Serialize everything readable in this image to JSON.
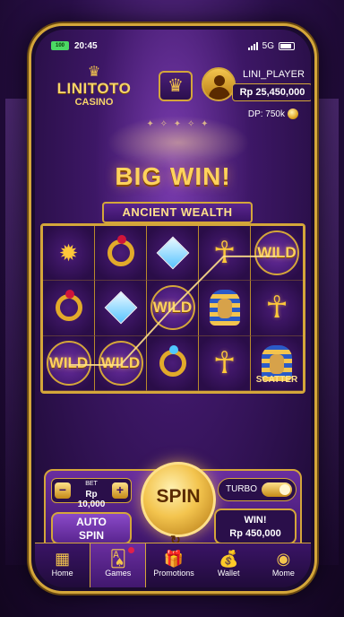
{
  "status_bar": {
    "battery_left": "100",
    "time": "20:45",
    "network": "5G"
  },
  "header": {
    "logo_title": "LINITOTO",
    "logo_subtitle": "CASINO",
    "username": "LINI_PLAYER",
    "balance": "Rp 25,450,000",
    "dp": "DP: 750k"
  },
  "game": {
    "big_win": "BIG WIN!",
    "name": "ANCIENT WEALTH"
  },
  "reels": [
    [
      "scarab",
      "ring-red",
      "diamond",
      "ankh",
      "wild"
    ],
    [
      "ring-red",
      "diamond",
      "wild",
      "pharaoh",
      "ankh"
    ],
    [
      "wild",
      "wild",
      "ring-blue",
      "ankh",
      "scatter"
    ]
  ],
  "symbol_labels": {
    "wild": "WILD",
    "scatter": "SCATTER"
  },
  "controls": {
    "bet_label": "BET",
    "bet_value": "Rp 10,000",
    "bet_minus": "−",
    "bet_plus": "+",
    "auto_spin_line1": "AUTO",
    "auto_spin_line2": "SPIN",
    "spin_label": "SPIN",
    "turbo_label": "TURBO",
    "turbo_on": true,
    "win_label": "WIN!",
    "win_amount": "Rp 450,000"
  },
  "nav": [
    {
      "label": "Home",
      "icon": "slot-machine-icon",
      "active": false
    },
    {
      "label": "Games",
      "icon": "cards-icon",
      "active": true
    },
    {
      "label": "Promotions",
      "icon": "gift-icon",
      "active": false
    },
    {
      "label": "Wallet",
      "icon": "money-bag-icon",
      "active": false
    },
    {
      "label": "Mome",
      "icon": "profile-icon",
      "active": false
    }
  ],
  "colors": {
    "gold": "#d4a63a",
    "purple": "#3a1466",
    "win_gold": "#ffd35c"
  }
}
